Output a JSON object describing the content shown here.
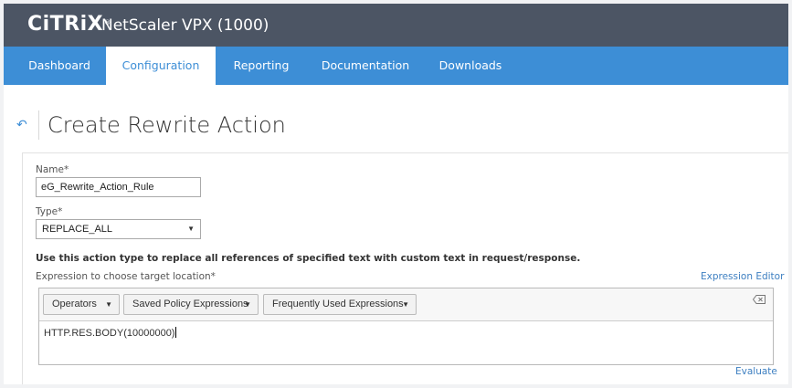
{
  "header": {
    "logo": "CiTRiX",
    "logo_mark": "®",
    "product": "NetScaler VPX (1000)"
  },
  "nav": {
    "tabs": [
      {
        "label": "Dashboard",
        "active": false
      },
      {
        "label": "Configuration",
        "active": true
      },
      {
        "label": "Reporting",
        "active": false
      },
      {
        "label": "Documentation",
        "active": false
      },
      {
        "label": "Downloads",
        "active": false
      }
    ]
  },
  "page": {
    "back_icon": "back-arrow-icon",
    "title": "Create Rewrite Action"
  },
  "form": {
    "name_label": "Name*",
    "name_value": "eG_Rewrite_Action_Rule",
    "type_label": "Type*",
    "type_value": "REPLACE_ALL",
    "hint": "Use this action type to replace all references of specified text with custom text in request/response.",
    "expression_label": "Expression to choose target location*",
    "expression_editor_link": "Expression Editor",
    "toolbar": {
      "operators": "Operators",
      "saved": "Saved Policy Expressions",
      "frequent": "Frequently Used Expressions"
    },
    "expression_value": "HTTP.RES.BODY(10000000)",
    "evaluate_link": "Evaluate"
  },
  "colors": {
    "titlebar": "#4c5564",
    "nav": "#3d8ed6",
    "link": "#3d7fc1"
  }
}
